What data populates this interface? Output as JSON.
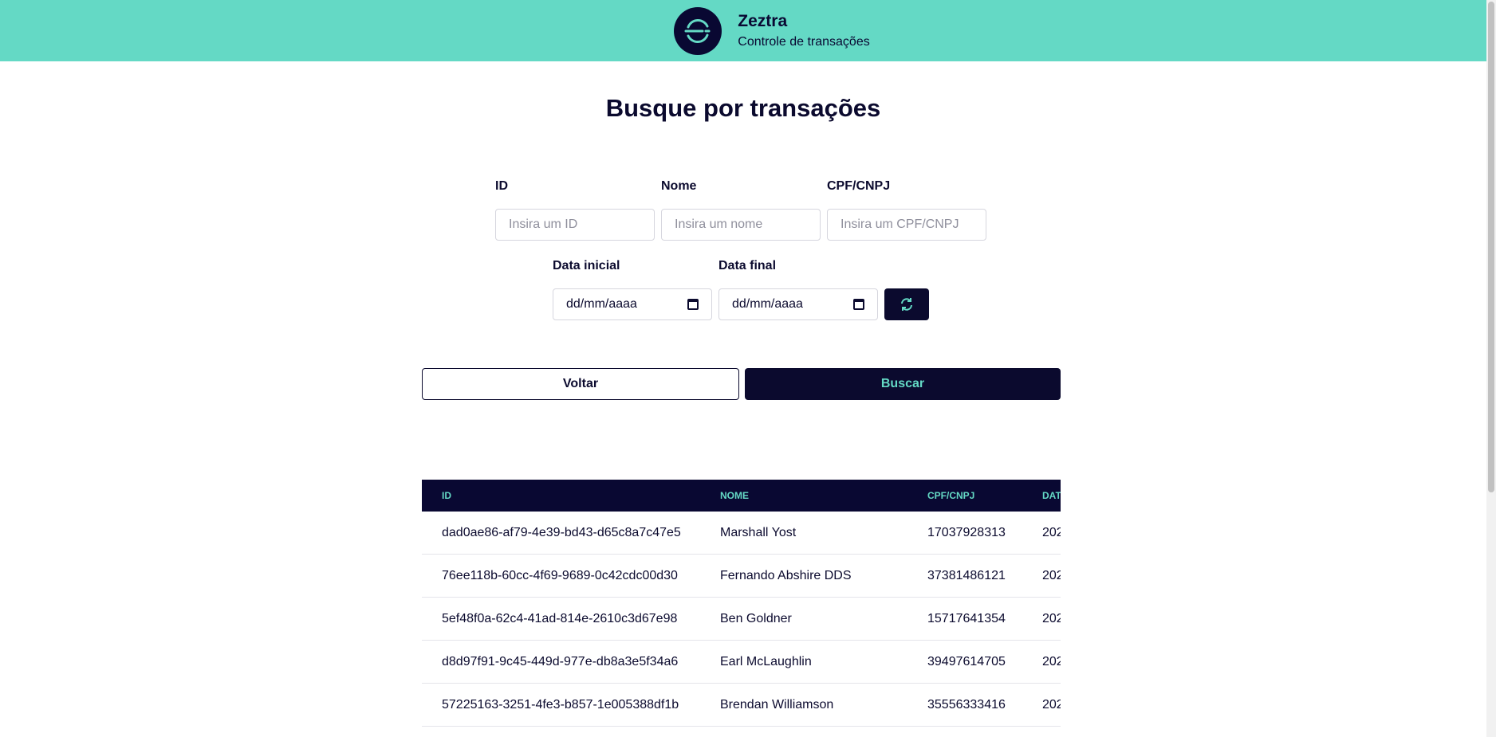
{
  "header": {
    "brand_name": "Zeztra",
    "subtitle": "Controle de transações"
  },
  "page": {
    "title": "Busque por transações"
  },
  "filters": {
    "id": {
      "label": "ID",
      "placeholder": "Insira um ID"
    },
    "name": {
      "label": "Nome",
      "placeholder": "Insira um nome"
    },
    "doc": {
      "label": "CPF/CNPJ",
      "placeholder": "Insira um CPF/CNPJ"
    },
    "start_date": {
      "label": "Data inicial",
      "value": "dd/mm/aaaa"
    },
    "end_date": {
      "label": "Data final",
      "value": "dd/mm/aaaa"
    }
  },
  "actions": {
    "back": "Voltar",
    "search": "Buscar"
  },
  "table": {
    "columns": [
      "ID",
      "NOME",
      "CPF/CNPJ",
      "DAT"
    ],
    "rows": [
      {
        "id": "dad0ae86-af79-4e39-bd43-d65c8a7c47e5",
        "name": "Marshall Yost",
        "doc": "17037928313",
        "date": "202"
      },
      {
        "id": "76ee118b-60cc-4f69-9689-0c42cdc00d30",
        "name": "Fernando Abshire DDS",
        "doc": "37381486121",
        "date": "202"
      },
      {
        "id": "5ef48f0a-62c4-41ad-814e-2610c3d67e98",
        "name": "Ben Goldner",
        "doc": "15717641354",
        "date": "202"
      },
      {
        "id": "d8d97f91-9c45-449d-977e-db8a3e5f34a6",
        "name": "Earl McLaughlin",
        "doc": "39497614705",
        "date": "202"
      },
      {
        "id": "57225163-3251-4fe3-b857-1e005388df1b",
        "name": "Brendan Williamson",
        "doc": "35556333416",
        "date": "202"
      }
    ]
  },
  "colors": {
    "brand": "#64d9c5",
    "dark": "#090832"
  },
  "icons": {
    "logo": "zeztra-logo-icon",
    "refresh": "refresh-icon",
    "calendar": "calendar-icon"
  }
}
